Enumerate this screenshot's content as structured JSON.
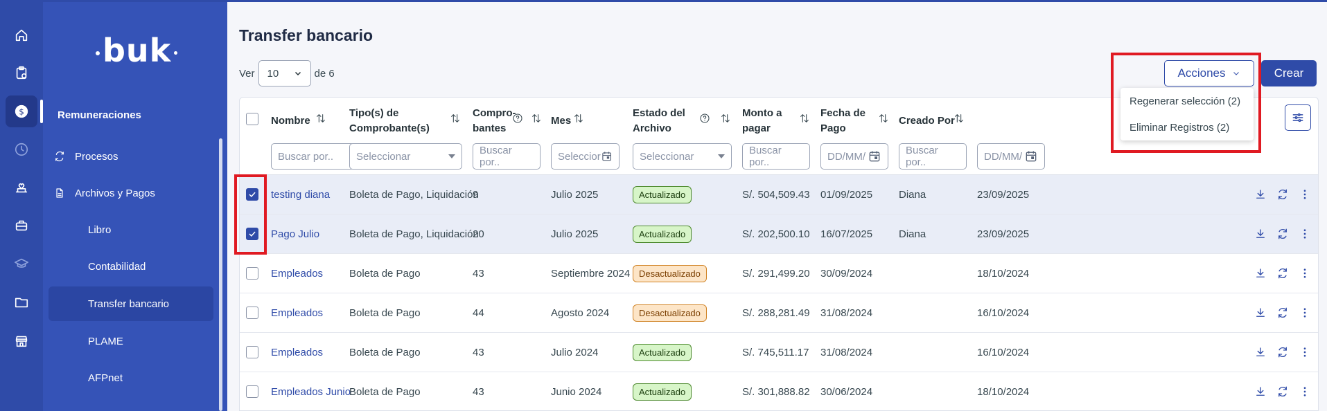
{
  "sidebar": {
    "logo": "buk",
    "section": "Remuneraciones",
    "items": [
      {
        "label": "Procesos",
        "icon": "refresh-icon"
      },
      {
        "label": "Archivos y Pagos",
        "icon": "file-icon"
      }
    ],
    "subitems": [
      "Libro",
      "Contabilidad",
      "Transfer bancario",
      "PLAME",
      "AFPnet"
    ],
    "active_subitem": "Transfer bancario"
  },
  "rail_icons": [
    "home-icon",
    "clipboard-icon",
    "dollar-icon",
    "clock-icon",
    "benefits-icon",
    "briefcase-icon",
    "graduation-icon",
    "folder-icon",
    "store-icon"
  ],
  "page": {
    "title": "Transfer bancario",
    "ver_label": "Ver",
    "page_size": "10",
    "of_label": "de 6",
    "acciones_label": "Acciones",
    "crear_label": "Crear"
  },
  "dropdown": {
    "items": [
      "Regenerar selección (2)",
      "Eliminar Registros (2)"
    ]
  },
  "columns": [
    {
      "line1": "Nombre",
      "line2": "",
      "filter": "Buscar por.."
    },
    {
      "line1": "Tipo(s) de",
      "line2": "Comprobante(s)",
      "filter": "Seleccionar"
    },
    {
      "line1": "Compro-",
      "line2": "bantes",
      "filter": "Buscar por.."
    },
    {
      "line1": "Mes",
      "line2": "",
      "filter": "Seleccior"
    },
    {
      "line1": "Estado del",
      "line2": "Archivo",
      "filter": "Seleccionar"
    },
    {
      "line1": "Monto a",
      "line2": "pagar",
      "filter": "Buscar por.."
    },
    {
      "line1": "Fecha de",
      "line2": "Pago",
      "filter": "DD/MM/"
    },
    {
      "line1": "Creado Por",
      "line2": "",
      "filter": "Buscar por.."
    },
    {
      "line1": "",
      "line2": "",
      "filter": "DD/MM/"
    }
  ],
  "rows": [
    {
      "nombre": "testing diana",
      "tipo": "Boleta de Pago, Liquidación",
      "comprobantes": "9",
      "mes": "Julio 2025",
      "estado": "Actualizado",
      "estado_kind": "ok",
      "monto": "S/. 504,509.43",
      "fecha_pago": "01/09/2025",
      "creado_por": "Diana",
      "fecha": "23/09/2025",
      "checked": true
    },
    {
      "nombre": "Pago Julio",
      "tipo": "Boleta de Pago, Liquidación",
      "comprobantes": "20",
      "mes": "Julio 2025",
      "estado": "Actualizado",
      "estado_kind": "ok",
      "monto": "S/. 202,500.10",
      "fecha_pago": "16/07/2025",
      "creado_por": "Diana",
      "fecha": "23/09/2025",
      "checked": true
    },
    {
      "nombre": "Empleados",
      "tipo": "Boleta de Pago",
      "comprobantes": "43",
      "mes": "Septiembre 2024",
      "estado": "Desactualizado",
      "estado_kind": "warn",
      "monto": "S/. 291,499.20",
      "fecha_pago": "30/09/2024",
      "creado_por": "",
      "fecha": "18/10/2024",
      "checked": false
    },
    {
      "nombre": "Empleados",
      "tipo": "Boleta de Pago",
      "comprobantes": "44",
      "mes": "Agosto 2024",
      "estado": "Desactualizado",
      "estado_kind": "warn",
      "monto": "S/. 288,281.49",
      "fecha_pago": "31/08/2024",
      "creado_por": "",
      "fecha": "16/10/2024",
      "checked": false
    },
    {
      "nombre": "Empleados",
      "tipo": "Boleta de Pago",
      "comprobantes": "43",
      "mes": "Julio 2024",
      "estado": "Actualizado",
      "estado_kind": "ok",
      "monto": "S/. 745,511.17",
      "fecha_pago": "31/08/2024",
      "creado_por": "",
      "fecha": "16/10/2024",
      "checked": false
    },
    {
      "nombre": "Empleados Junio",
      "tipo": "Boleta de Pago",
      "comprobantes": "43",
      "mes": "Junio 2024",
      "estado": "Actualizado",
      "estado_kind": "ok",
      "monto": "S/. 301,888.82",
      "fecha_pago": "30/06/2024",
      "creado_por": "",
      "fecha": "18/10/2024",
      "checked": false
    }
  ],
  "colors": {
    "primary": "#2f4ba8",
    "highlight": "#e01a22"
  }
}
